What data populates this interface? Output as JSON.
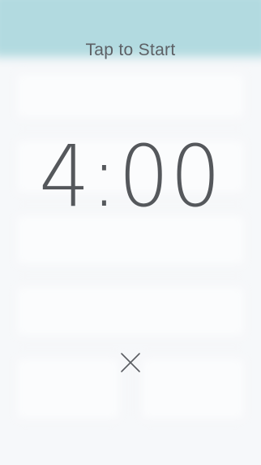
{
  "overlay": {
    "prompt": "Tap to Start",
    "timer": "4:00"
  },
  "icons": {
    "close": "close-icon"
  },
  "colors": {
    "nav_bar": "#5db4be",
    "text": "#55585c",
    "background": "#f4f5f8"
  }
}
